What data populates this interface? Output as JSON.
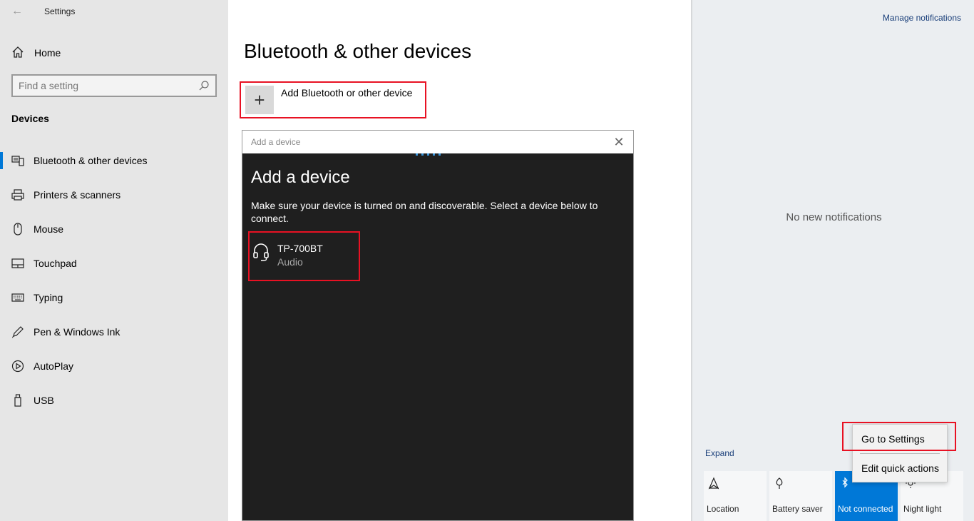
{
  "window": {
    "title": "Settings",
    "back_glyph": "←"
  },
  "sidebar": {
    "home_label": "Home",
    "search_placeholder": "Find a setting",
    "section_title": "Devices",
    "items": [
      {
        "label": "Bluetooth & other devices",
        "icon": "bluetooth-devices-icon",
        "active": true
      },
      {
        "label": "Printers & scanners",
        "icon": "printer-icon"
      },
      {
        "label": "Mouse",
        "icon": "mouse-icon"
      },
      {
        "label": "Touchpad",
        "icon": "touchpad-icon"
      },
      {
        "label": "Typing",
        "icon": "keyboard-icon"
      },
      {
        "label": "Pen & Windows Ink",
        "icon": "pen-icon"
      },
      {
        "label": "AutoPlay",
        "icon": "autoplay-icon"
      },
      {
        "label": "USB",
        "icon": "usb-icon"
      }
    ]
  },
  "main": {
    "title": "Bluetooth & other devices",
    "add_device_label": "Add Bluetooth or other device",
    "add_plus_glyph": "+"
  },
  "dialog": {
    "window_title": "Add a device",
    "close_glyph": "✕",
    "heading": "Add a device",
    "description": "Make sure your device is turned on and discoverable. Select a device below to connect.",
    "devices": [
      {
        "name": "TP-700BT",
        "type": "Audio",
        "icon": "headset-icon"
      }
    ]
  },
  "action_center": {
    "manage_notifications": "Manage notifications",
    "no_notifications": "No new notifications",
    "expand": "Expand",
    "tiles": [
      {
        "label": "Location",
        "icon": "location-icon",
        "on": false
      },
      {
        "label": "Battery saver",
        "icon": "battery-saver-icon",
        "on": false
      },
      {
        "label": "Not connected",
        "icon": "bluetooth-icon",
        "on": true
      },
      {
        "label": "Night light",
        "icon": "night-light-icon",
        "on": false
      }
    ],
    "context_menu": {
      "items": [
        "Go to Settings",
        "Edit quick actions"
      ]
    }
  },
  "colors": {
    "accent": "#0078d7",
    "highlight": "#e81123",
    "sidebar_bg": "#e6e6e6",
    "dialog_bg": "#1f1f1f",
    "action_center_bg": "#ebeef1"
  }
}
